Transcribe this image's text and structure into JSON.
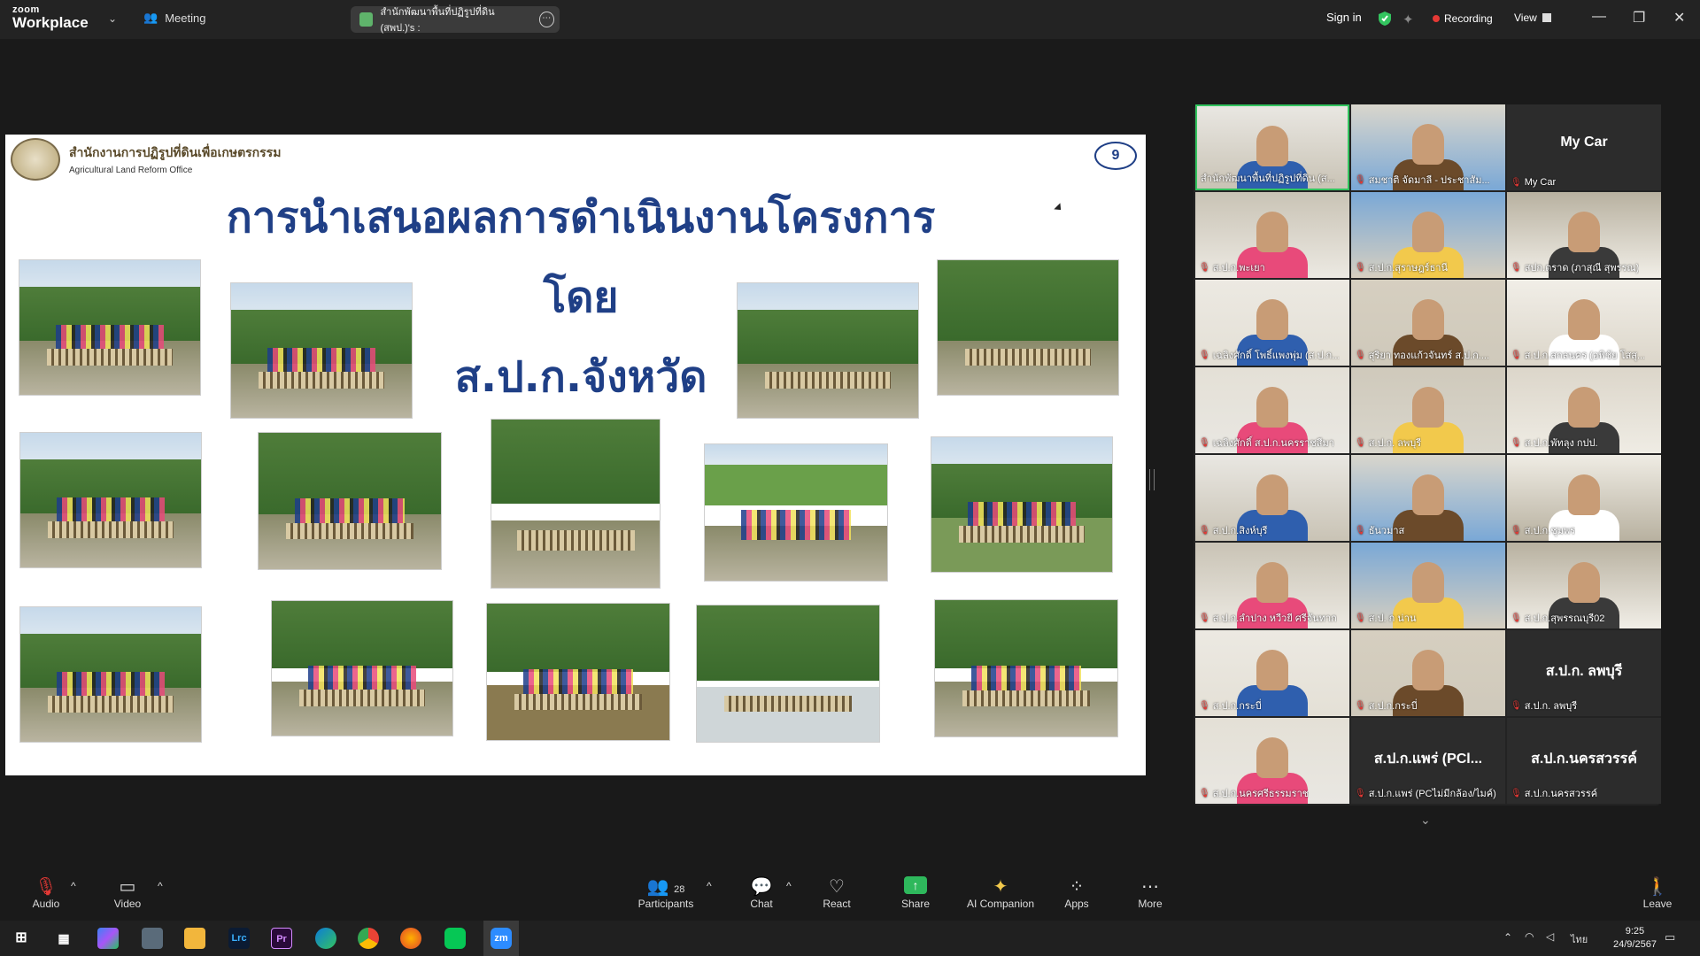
{
  "app": {
    "logo_top": "zoom",
    "logo_bottom": "Workplace",
    "meeting_label": "Meeting",
    "tab_title": "สำนักพัฒนาพื้นที่ปฏิรูปที่ดิน (สพป.)'s :",
    "sign_in": "Sign in",
    "recording": "Recording",
    "view": "View"
  },
  "slide": {
    "org_th": "สำนักงานการปฏิรูปที่ดินเพื่อเกษตรกรรม",
    "org_en": "Agricultural Land Reform Office",
    "page_number": "9",
    "title_line1": "การนำเสนอผลการดำเนินงานโครงการ",
    "title_line2": "โดย",
    "title_line3": "ส.ป.ก.จังหวัด"
  },
  "participants": [
    {
      "name": "สำนักพัฒนาพื้นที่ปฏิรูปที่ดิน (ส...",
      "muted": false,
      "video": true,
      "active": true
    },
    {
      "name": "สมชาติ จัดมาลี - ประชาสัม...",
      "muted": true,
      "video": true
    },
    {
      "name": "My   Car",
      "muted": true,
      "video": false,
      "display": "My   Car"
    },
    {
      "name": "ส.ป.ก.พะเยา",
      "muted": true,
      "video": true
    },
    {
      "name": "ส.ป.ก.สุราษฎร์ธานี",
      "muted": true,
      "video": true
    },
    {
      "name": "สปก.ตราด (ภาสุณี สุพรรณ)",
      "muted": true,
      "video": true
    },
    {
      "name": "เฉลิงศักดิ์ โพธิ์แพงพุ่ม (ส.ป.ก...",
      "muted": true,
      "video": true
    },
    {
      "name": "สุริยา ทองแก้วจันทร์ ส.ป.ก....",
      "muted": true,
      "video": true
    },
    {
      "name": "ส.ป.ก.สกลนคร (อพิชัย  โสสุ...",
      "muted": true,
      "video": true
    },
    {
      "name": "เฉลิงศักดิ์ ส.ป.ก.นครราชสีมา",
      "muted": true,
      "video": true
    },
    {
      "name": "ส.ป.ก. ลพบุรี",
      "muted": true,
      "video": true
    },
    {
      "name": "ส.ป.ก.พัทลุง กปป.",
      "muted": true,
      "video": true
    },
    {
      "name": "ส.ป.ก.สิงห์บุรี",
      "muted": true,
      "video": true
    },
    {
      "name": "ธันวมาส",
      "muted": true,
      "video": true
    },
    {
      "name": "ส.ป.ก.ชุมพร",
      "muted": true,
      "video": true
    },
    {
      "name": "ส.ป.ก.ลำปาง หวีวยี ศรีจันทาก",
      "muted": true,
      "video": true
    },
    {
      "name": "ส.ป. ก น่าน",
      "muted": true,
      "video": true
    },
    {
      "name": "ส.ป.ก.สุพรรณบุรี02",
      "muted": true,
      "video": true
    },
    {
      "name": "ส.ป.ก.กระบี่",
      "muted": true,
      "video": true
    },
    {
      "name": "ส.ป.ก.กระบี่",
      "muted": true,
      "video": true
    },
    {
      "name": "ส.ป.ก. ลพบุรี",
      "muted": true,
      "video": false,
      "display": "ส.ป.ก. ลพบุรี"
    },
    {
      "name": "ส.ป.ก.นครศรีธรรมราช",
      "muted": true,
      "video": true
    },
    {
      "name": "ส.ป.ก.แพร่ (PCไม่มีกล้อง/ไมค์)",
      "muted": true,
      "video": false,
      "display": "ส.ป.ก.แพร่ (PCl..."
    },
    {
      "name": "ส.ป.ก.นครสวรรค์",
      "muted": true,
      "video": false,
      "display": "ส.ป.ก.นครสวรรค์"
    }
  ],
  "toolbar": {
    "audio": "Audio",
    "video": "Video",
    "participants": "Participants",
    "participants_count": "28",
    "chat": "Chat",
    "react": "React",
    "share": "Share",
    "ai_companion": "AI Companion",
    "apps": "Apps",
    "more": "More",
    "leave": "Leave"
  },
  "taskbar": {
    "lang": "ไทย",
    "time": "9:25",
    "date": "24/9/2567",
    "apps": [
      "Lrc",
      "Pr",
      "zm"
    ]
  },
  "colors": {
    "slide_title": "#1f3f86",
    "active_speaker": "#33c45f",
    "recording_dot": "#e53935",
    "share": "#2eb85c"
  }
}
